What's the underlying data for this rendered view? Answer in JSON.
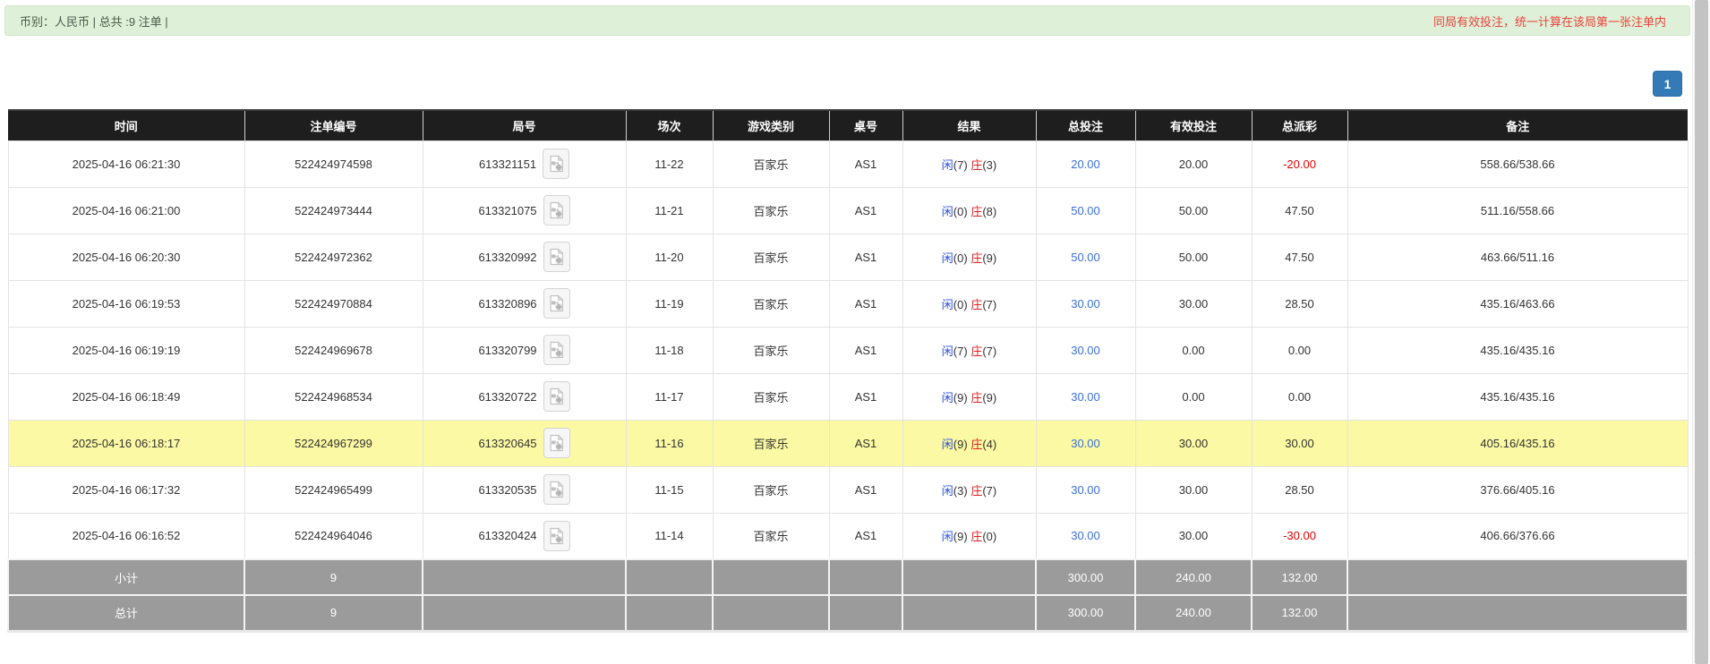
{
  "meta_bar": {
    "summary": "币别：人民币 | 总共 :9 注单 |",
    "notice": "同局有效投注，统一计算在该局第一张注单内"
  },
  "pagination": {
    "current_page": "1"
  },
  "table": {
    "headers": [
      "时间",
      "注单编号",
      "局号",
      "场次",
      "游戏类别",
      "桌号",
      "结果",
      "总投注",
      "有效投注",
      "总派彩",
      "备注"
    ],
    "rows": [
      {
        "time": "2025-04-16 06:21:30",
        "bet_id": "522424974598",
        "round_id": "613321151",
        "session": "11-22",
        "game_type": "百家乐",
        "table_no": "AS1",
        "result": {
          "player": "闲",
          "player_score": "(7)",
          "banker": "庄",
          "banker_score": "(3)"
        },
        "total_bet": "20.00",
        "valid_bet": "20.00",
        "payout": "-20.00",
        "remark": "558.66/538.66",
        "highlighted": false
      },
      {
        "time": "2025-04-16 06:21:00",
        "bet_id": "522424973444",
        "round_id": "613321075",
        "session": "11-21",
        "game_type": "百家乐",
        "table_no": "AS1",
        "result": {
          "player": "闲",
          "player_score": "(0)",
          "banker": "庄",
          "banker_score": "(8)"
        },
        "total_bet": "50.00",
        "valid_bet": "50.00",
        "payout": "47.50",
        "remark": "511.16/558.66",
        "highlighted": false
      },
      {
        "time": "2025-04-16 06:20:30",
        "bet_id": "522424972362",
        "round_id": "613320992",
        "session": "11-20",
        "game_type": "百家乐",
        "table_no": "AS1",
        "result": {
          "player": "闲",
          "player_score": "(0)",
          "banker": "庄",
          "banker_score": "(9)"
        },
        "total_bet": "50.00",
        "valid_bet": "50.00",
        "payout": "47.50",
        "remark": "463.66/511.16",
        "highlighted": false
      },
      {
        "time": "2025-04-16 06:19:53",
        "bet_id": "522424970884",
        "round_id": "613320896",
        "session": "11-19",
        "game_type": "百家乐",
        "table_no": "AS1",
        "result": {
          "player": "闲",
          "player_score": "(0)",
          "banker": "庄",
          "banker_score": "(7)"
        },
        "total_bet": "30.00",
        "valid_bet": "30.00",
        "payout": "28.50",
        "remark": "435.16/463.66",
        "highlighted": false
      },
      {
        "time": "2025-04-16 06:19:19",
        "bet_id": "522424969678",
        "round_id": "613320799",
        "session": "11-18",
        "game_type": "百家乐",
        "table_no": "AS1",
        "result": {
          "player": "闲",
          "player_score": "(7)",
          "banker": "庄",
          "banker_score": "(7)"
        },
        "total_bet": "30.00",
        "valid_bet": "0.00",
        "payout": "0.00",
        "remark": "435.16/435.16",
        "highlighted": false
      },
      {
        "time": "2025-04-16 06:18:49",
        "bet_id": "522424968534",
        "round_id": "613320722",
        "session": "11-17",
        "game_type": "百家乐",
        "table_no": "AS1",
        "result": {
          "player": "闲",
          "player_score": "(9)",
          "banker": "庄",
          "banker_score": "(9)"
        },
        "total_bet": "30.00",
        "valid_bet": "0.00",
        "payout": "0.00",
        "remark": "435.16/435.16",
        "highlighted": false
      },
      {
        "time": "2025-04-16 06:18:17",
        "bet_id": "522424967299",
        "round_id": "613320645",
        "session": "11-16",
        "game_type": "百家乐",
        "table_no": "AS1",
        "result": {
          "player": "闲",
          "player_score": "(9)",
          "banker": "庄",
          "banker_score": "(4)"
        },
        "total_bet": "30.00",
        "valid_bet": "30.00",
        "payout": "30.00",
        "remark": "405.16/435.16",
        "highlighted": true
      },
      {
        "time": "2025-04-16 06:17:32",
        "bet_id": "522424965499",
        "round_id": "613320535",
        "session": "11-15",
        "game_type": "百家乐",
        "table_no": "AS1",
        "result": {
          "player": "闲",
          "player_score": "(3)",
          "banker": "庄",
          "banker_score": "(7)"
        },
        "total_bet": "30.00",
        "valid_bet": "30.00",
        "payout": "28.50",
        "remark": "376.66/405.16",
        "highlighted": false
      },
      {
        "time": "2025-04-16 06:16:52",
        "bet_id": "522424964046",
        "round_id": "613320424",
        "session": "11-14",
        "game_type": "百家乐",
        "table_no": "AS1",
        "result": {
          "player": "闲",
          "player_score": "(9)",
          "banker": "庄",
          "banker_score": "(0)"
        },
        "total_bet": "30.00",
        "valid_bet": "30.00",
        "payout": "-30.00",
        "remark": "406.66/376.66",
        "highlighted": false
      }
    ],
    "footer_rows": [
      {
        "label": "小计",
        "count": "9",
        "total_bet": "300.00",
        "valid_bet": "240.00",
        "payout": "132.00"
      },
      {
        "label": "总计",
        "count": "9",
        "total_bet": "300.00",
        "valid_bet": "240.00",
        "payout": "132.00"
      }
    ]
  },
  "icons": {
    "round_video_icon": "video-file-icon"
  },
  "colors": {
    "bar_green": "#dff0d8",
    "notice_red": "#e8433d",
    "accent_blue": "#337ab7",
    "link_blue": "#3a6fe0",
    "player_blue": "#2b51d8",
    "banker_red": "#e02020",
    "negative_red": "#e60000",
    "highlight_yellow": "#fbf9a3",
    "header_black": "#1e1e1e",
    "footer_gray": "#9b9b9b"
  }
}
